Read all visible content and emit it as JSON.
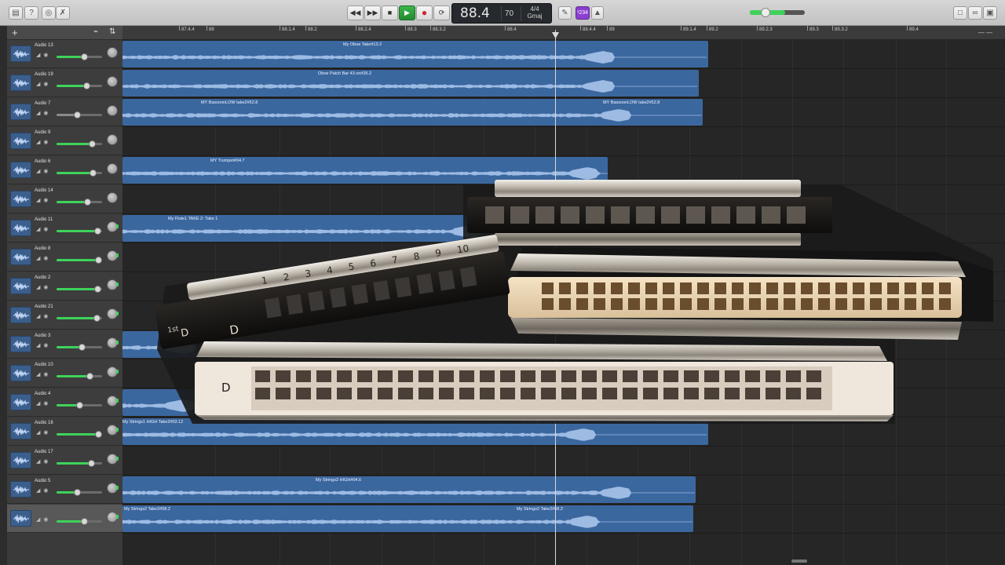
{
  "toolbar": {
    "left_icons": [
      "library-icon",
      "help-icon",
      "smart-controls-icon",
      "editors-icon"
    ],
    "transport_icons": [
      "rewind-icon",
      "fast-forward-icon",
      "stop-icon",
      "play-icon",
      "record-icon",
      "cycle-icon"
    ],
    "position": "88.4",
    "tempo": "70",
    "time_signature": "4/4",
    "key": "Gmaj",
    "count_in": "¹234",
    "master_volume": 0.65,
    "right_icons": [
      "notepad-icon",
      "loop-browser-icon",
      "media-browser-icon"
    ]
  },
  "tracks": [
    {
      "name": "Audio 13",
      "volume": 0.6,
      "pan_on": false
    },
    {
      "name": "Audio 19",
      "volume": 0.65,
      "pan_on": false
    },
    {
      "name": "Audio 7",
      "volume": 0.45,
      "pan_on": false
    },
    {
      "name": "Audio 9",
      "volume": 0.78,
      "pan_on": false
    },
    {
      "name": "Audio 6",
      "volume": 0.8,
      "pan_on": false
    },
    {
      "name": "Audio 14",
      "volume": 0.68,
      "pan_on": false
    },
    {
      "name": "Audio 11",
      "volume": 0.9,
      "pan_on": true
    },
    {
      "name": "Audio 8",
      "volume": 0.92,
      "pan_on": true
    },
    {
      "name": "Audio 2",
      "volume": 0.9,
      "pan_on": true
    },
    {
      "name": "Audio 21",
      "volume": 0.88,
      "pan_on": true
    },
    {
      "name": "Audio 3",
      "volume": 0.55,
      "pan_on": true
    },
    {
      "name": "Audio 10",
      "volume": 0.72,
      "pan_on": true
    },
    {
      "name": "Audio 4",
      "volume": 0.5,
      "pan_on": true
    },
    {
      "name": "Audio 16",
      "volume": 0.92,
      "pan_on": true
    },
    {
      "name": "Audio 17",
      "volume": 0.75,
      "pan_on": true
    },
    {
      "name": "Audio 5",
      "volume": 0.45,
      "pan_on": true
    },
    {
      "name": "",
      "volume": 0.6,
      "pan_on": true
    }
  ],
  "ruler_ticks": [
    "87.4.4",
    "88",
    "88.1.4",
    "88.2",
    "88.2.4",
    "88.3",
    "88.3.2",
    "88.4",
    "88.4.4",
    "89",
    "89.1.4",
    "89.2",
    "89.2.3",
    "89.3",
    "89.3.2",
    "89.4"
  ],
  "regions": [
    {
      "lane": 0,
      "labels": [
        "My Oboe Take#13.2"
      ]
    },
    {
      "lane": 1,
      "labels": [
        "Oboe Patch Bar 43 on#35.2"
      ]
    },
    {
      "lane": 2,
      "labels": [
        "MY BassoonLOW take2#52.8",
        "MY BassoonLOW take2#52.8"
      ]
    },
    {
      "lane": 4,
      "labels": [
        "MY Trumpet#04.7"
      ]
    },
    {
      "lane": 6,
      "labels": [
        "My Flute1 TAKE 2: Take 1"
      ]
    },
    {
      "lane": 10,
      "labels": [
        ""
      ]
    },
    {
      "lane": 12,
      "labels": [
        ""
      ]
    },
    {
      "lane": 13,
      "labels": [
        "My Strings1 HIGH Take2#03.12",
        "My Strings1 HIGH Take2#03.12"
      ]
    },
    {
      "lane": 15,
      "labels": [
        "My Strings2 HIGH#04.6"
      ]
    },
    {
      "lane": 16,
      "labels": [
        "My Strings2 Take2#58.2",
        "My Strings2 Take2#58.2"
      ]
    }
  ],
  "overlay": {
    "harmonica_letters": [
      "D",
      "D",
      "D"
    ],
    "harmonica_numbers": [
      "1",
      "2",
      "3",
      "4",
      "5",
      "6",
      "7",
      "8",
      "9",
      "10"
    ],
    "first_position_mark": "1st"
  }
}
